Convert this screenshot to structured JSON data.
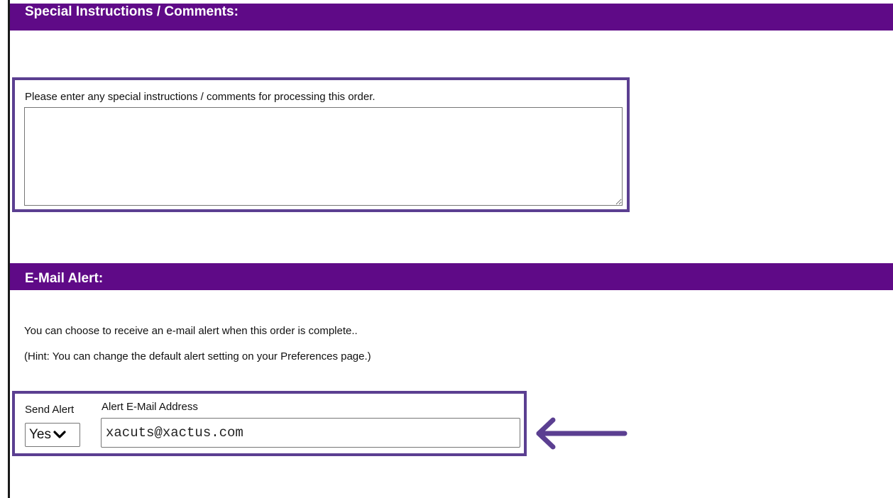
{
  "special_instructions": {
    "header": "Special Instructions / Comments:",
    "label": "Please enter any special instructions / comments for processing this order.",
    "value": ""
  },
  "email_alert": {
    "header": "E-Mail Alert:",
    "info": "You can choose to receive an e-mail alert when this order is complete..",
    "hint": "(Hint: You can change the default alert setting on your Preferences page.)",
    "send_alert_label": "Send Alert",
    "send_alert_value": "Yes",
    "address_label": "Alert E-Mail Address",
    "address_value": "xacuts@xactus.com"
  },
  "colors": {
    "header_bg": "#5f0a87",
    "highlight": "#5b3f91"
  },
  "icons": {
    "dropdown": "chevron-down-icon",
    "annotation": "arrow-left-icon"
  }
}
